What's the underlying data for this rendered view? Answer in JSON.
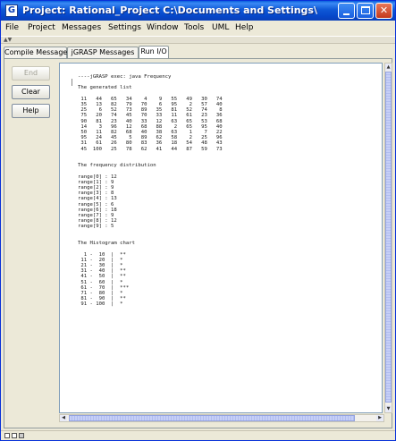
{
  "window": {
    "title": "Project: Rational_Project  C:\\Documents and Settings\\Bahram Zartos...",
    "icon_letter": "G",
    "colors": {
      "titlebar": "#0a5fdc",
      "close": "#c4391c"
    }
  },
  "menu": {
    "file": "File",
    "project": "Project",
    "messages": "Messages",
    "settings": "Settings",
    "window": "Window",
    "tools": "Tools",
    "uml": "UML",
    "help": "Help"
  },
  "tabs": {
    "compile": "Compile Messages",
    "jgrasp": "jGRASP Messages",
    "runio": "Run I/O"
  },
  "buttons": {
    "end": "End",
    "clear": "Clear",
    "help": "Help"
  },
  "output": {
    "text": "----jGRASP exec: java Frequency\n\nThe generated list\n\n 11   44   65   34    4    9   55   49   30   74\n 35   13   82   79   70    6   95    2   57   40\n 25    6   52   73   89   35   81   52   74    8\n 75   20   74   45   70   33   11   61   23   36\n 90   81   23   40   33   12   63   65   53   68\n 14    3   96   12   68   88    2   65   95   40\n 50   11   82   68   40   38   63    1    7   22\n 95   24   45    5   89   62   58    2   25   96\n 31   61   26   80   83   36   18   54   48   43\n 45  100   25   78   62   41   44   87   59   73\n\n\nThe frequency distribution\n\nrange[0] : 12\nrange[1] : 9\nrange[2] : 9\nrange[3] : 8\nrange[4] : 13\nrange[5] : 6\nrange[6] : 18\nrange[7] : 9\nrange[8] : 12\nrange[9] : 5\n\n\nThe Histogram chart\n\n  1 -  10  |  **\n 11 -  20  |  *\n 21 -  30  |  *\n 31 -  40  |  **\n 41 -  50  |  **\n 51 -  60  |  *\n 61 -  70  |  ***\n 71 -  80  |  *\n 81 -  90  |  **\n 91 - 100  |  *"
  }
}
